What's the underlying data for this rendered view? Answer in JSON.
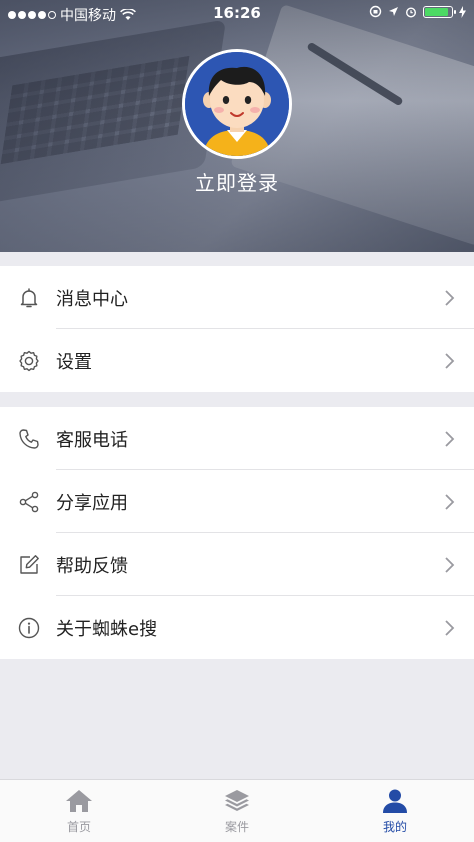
{
  "status_bar": {
    "carrier": "中国移动",
    "time": "16:26",
    "signal_bars": 4,
    "battery_level": 0.95
  },
  "profile": {
    "login_label": "立即登录"
  },
  "menu_groups": [
    {
      "items": [
        {
          "label": "消息中心",
          "icon": "bell-icon"
        },
        {
          "label": "设置",
          "icon": "gear-icon"
        }
      ]
    },
    {
      "items": [
        {
          "label": "客服电话",
          "icon": "phone-icon"
        },
        {
          "label": "分享应用",
          "icon": "share-icon"
        },
        {
          "label": "帮助反馈",
          "icon": "edit-icon"
        },
        {
          "label": "关于蜘蛛e搜",
          "icon": "info-icon"
        }
      ]
    }
  ],
  "tabs": [
    {
      "label": "首页",
      "icon": "home-icon",
      "active": false
    },
    {
      "label": "案件",
      "icon": "layers-icon",
      "active": false
    },
    {
      "label": "我的",
      "icon": "user-icon",
      "active": true
    }
  ],
  "colors": {
    "accent": "#234ba6",
    "inactive": "#9a9aa0",
    "background": "#ebebf0"
  }
}
